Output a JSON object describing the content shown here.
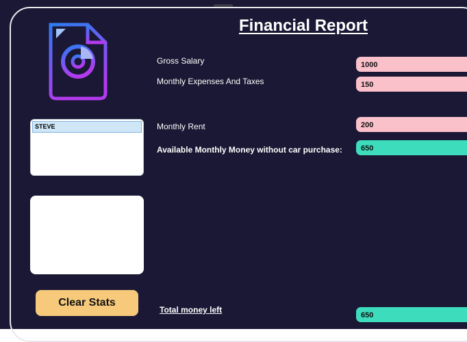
{
  "title": "Financial Report",
  "list": {
    "items": [
      "STEVE"
    ]
  },
  "clear_button": "Clear Stats",
  "rows": {
    "gross_salary": {
      "label": "Gross Salary",
      "value": "1000"
    },
    "monthly_expenses": {
      "label": "Monthly Expenses And Taxes",
      "value": "150"
    },
    "monthly_rent": {
      "label": "Monthly Rent",
      "value": "200"
    },
    "available_money": {
      "label": "Available Monthly Money without car purchase:",
      "value": "650"
    },
    "total_left": {
      "label": "Total money left",
      "value": "650"
    }
  },
  "colors": {
    "background": "#1a1834",
    "input_pink": "#fbc1cb",
    "output_teal": "#3ddcbd",
    "button": "#f7c97a"
  },
  "icons": {
    "logo": "report-document-pie-chart-icon"
  }
}
